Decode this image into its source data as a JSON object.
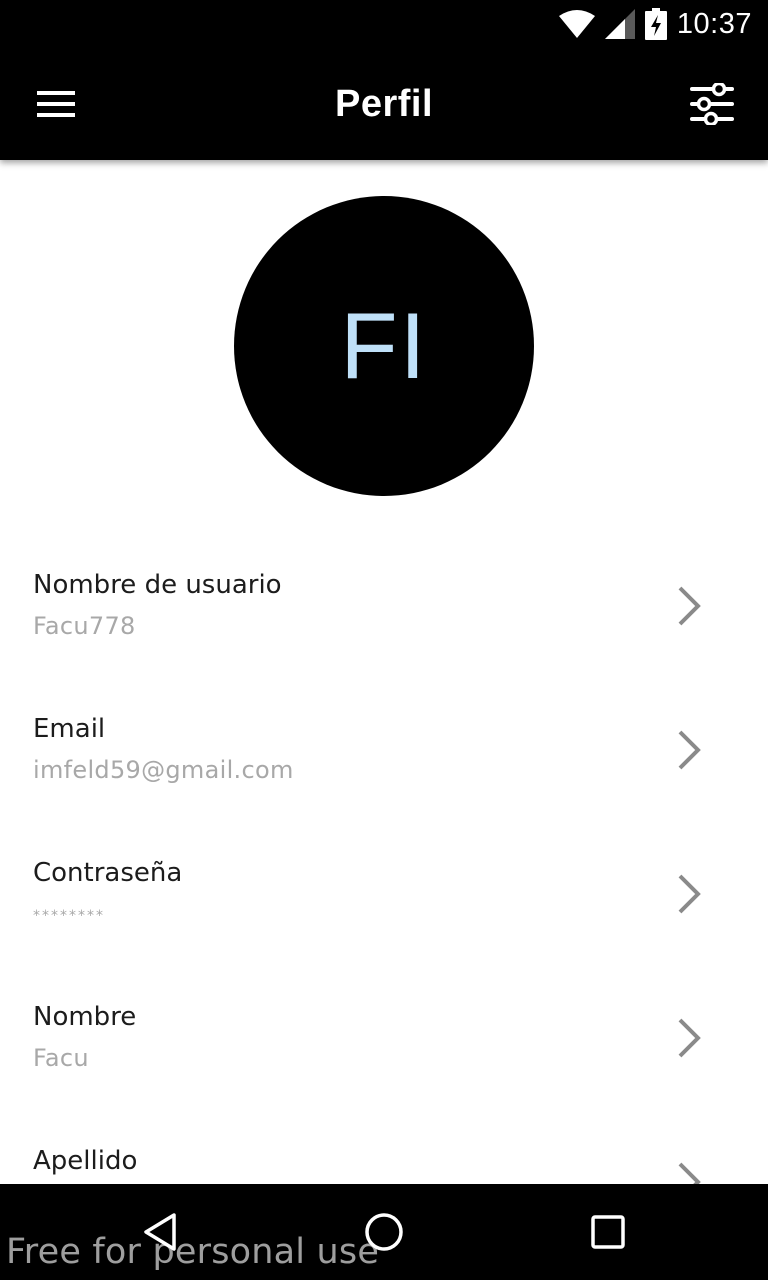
{
  "status_bar": {
    "time": "10:37",
    "icons": [
      "wifi-icon",
      "signal-icon",
      "battery-charging-icon"
    ]
  },
  "app_bar": {
    "title": "Perfil",
    "left_icon": "menu-icon",
    "right_icon": "filter-sliders-icon"
  },
  "profile": {
    "initials": "FI",
    "avatar_bg": "#000000",
    "initials_color": "#bfe0f8"
  },
  "fields": [
    {
      "label": "Nombre de usuario",
      "value": "Facu778"
    },
    {
      "label": "Email",
      "value": "imfeld59@gmail.com"
    },
    {
      "label": "Contraseña",
      "value": "********"
    },
    {
      "label": "Nombre",
      "value": "Facu"
    },
    {
      "label": "Apellido",
      "value": ""
    }
  ],
  "nav_bar": {
    "icons": [
      "back-triangle-icon",
      "home-circle-icon",
      "recents-square-icon"
    ]
  },
  "watermark": "Free for personal use",
  "colors": {
    "bar_bg": "#000000",
    "label": "#1c1c1c",
    "value": "#a8a8a8",
    "chevron": "#8a8a8a"
  }
}
